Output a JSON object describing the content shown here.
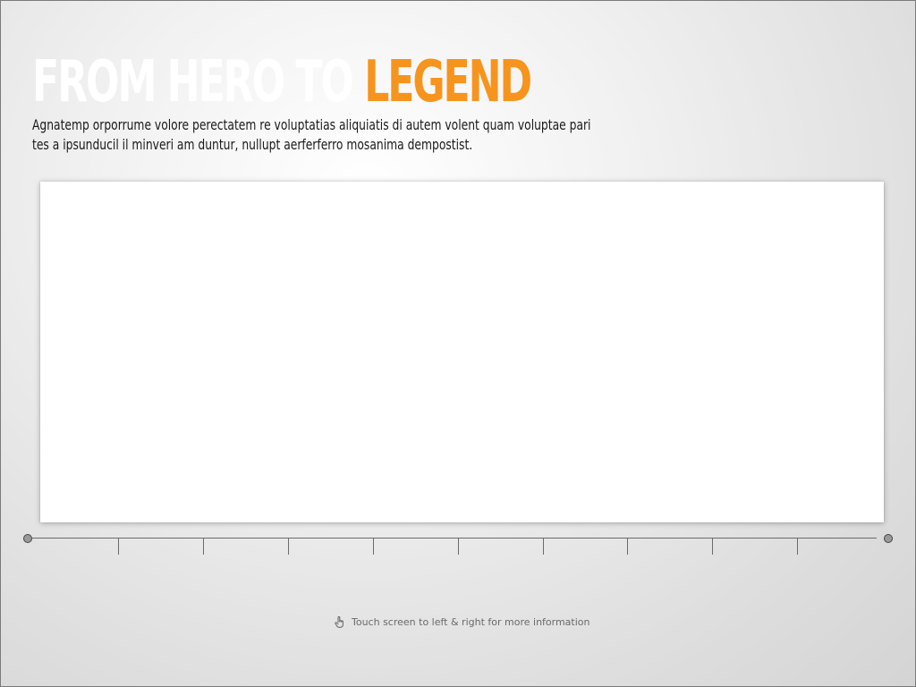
{
  "header": {
    "title_part1": "FROM HERO TO ",
    "title_part2": "LEGEND",
    "subtitle_line1": "Agnatemp orporrume volore perectatem re voluptatias aliquiatis di autem volent quam voluptae pari",
    "subtitle_line2": "tes a ipsunducil il minveri am duntur, nullupt aerferferro mosanima dempostist."
  },
  "timeline": {
    "tick_count": 9
  },
  "footer": {
    "hint_icon": "touch-hand-icon",
    "hint_text": "Touch screen to left & right for more information"
  },
  "colors": {
    "accent": "#f7941d",
    "title_white": "#ffffff",
    "text_dark": "#1a1a1a",
    "hint_gray": "#6a6a6a"
  }
}
